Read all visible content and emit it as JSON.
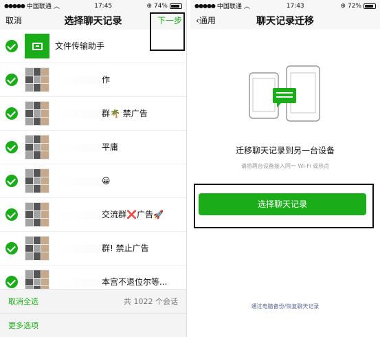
{
  "left": {
    "status": {
      "carrier": "中国联通",
      "wifi": "wifi-icon",
      "time": "17:45",
      "battery": "74%"
    },
    "nav": {
      "cancel": "取消",
      "title": "选择聊天记录",
      "next": "下一步"
    },
    "chats": [
      {
        "name": "文件传输助手",
        "avatar": "file-transfer-icon"
      },
      {
        "name": "作"
      },
      {
        "name": "群🌴 禁广告"
      },
      {
        "name": "平庸"
      },
      {
        "name": "😀"
      },
      {
        "name": "交流群❌广告🚀"
      },
      {
        "name": "群! 禁止广告"
      },
      {
        "name": "本宫不退位尔等..."
      }
    ],
    "bottom": {
      "deselect_all": "取消全选",
      "count": "共 1022 个会话",
      "more_options": "更多选项"
    }
  },
  "right": {
    "status": {
      "carrier": "中国联通",
      "wifi": "wifi-icon",
      "time": "17:43",
      "battery": "72%"
    },
    "nav": {
      "back": "通用",
      "title": "聊天记录迁移"
    },
    "heading": "迁移聊天记录到另一台设备",
    "hint": "请将两台设备接入同一 Wi-Fi 或热点",
    "select_button": "选择聊天记录",
    "pc_backup_link": "通过电脑备份/恢复聊天记录"
  },
  "colors": {
    "accent": "#1aad19",
    "link": "#576b95"
  }
}
